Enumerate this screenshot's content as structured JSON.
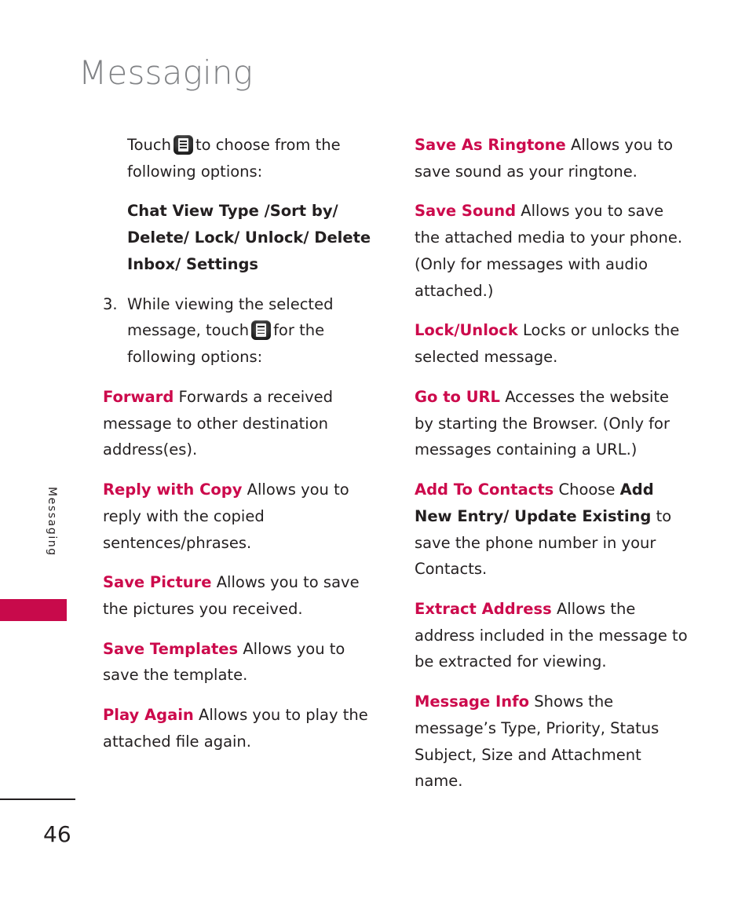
{
  "page": {
    "title": "Messaging",
    "side_tab_label": "Messaging",
    "page_number": "46",
    "accent_color": "#cc0a4c",
    "tab_color": "#c80a4b",
    "title_color": "#808285",
    "body_color": "#231f20"
  },
  "icons": {
    "menu_key": "menu-key-icon"
  },
  "left_column": {
    "intro": {
      "before_icon": "Touch",
      "after_icon": "to choose from the following options:"
    },
    "options_line": "Chat View Type /Sort by/ Delete/ Lock/ Unlock/ Delete Inbox/ Settings",
    "step": {
      "number": "3.",
      "before_icon": "While viewing the selected message, touch",
      "after_icon": "for the following options:"
    },
    "entries": [
      {
        "term": "Forward",
        "description": "Forwards a received message to other destination address(es)."
      },
      {
        "term": "Reply with Copy",
        "description": "Allows you to reply with the copied sentences/phrases."
      },
      {
        "term": "Save Picture",
        "description": "Allows you to save the pictures you received."
      },
      {
        "term": "Save Templates",
        "description": "Allows you to save the template."
      },
      {
        "term": "Play Again",
        "description": "Allows you to play the attached file again."
      }
    ]
  },
  "right_column": {
    "entries": [
      {
        "term": "Save As Ringtone",
        "description": "Allows you to save sound as your ringtone."
      },
      {
        "term": "Save Sound",
        "description": "Allows you to save the attached media to your phone. (Only for messages with audio attached.)"
      },
      {
        "term": "Lock/Unlock",
        "description": "Locks or unlocks the selected message."
      },
      {
        "term": "Go to URL",
        "description": "Accesses the website by starting the Browser. (Only for messages containing a URL.)"
      },
      {
        "term": "Add To Contacts",
        "description_1": "Choose",
        "emphasis": "Add New Entry/ Update Existing",
        "description_2": "to save the phone number in your Contacts."
      },
      {
        "term": "Extract Address",
        "description": "Allows the address included in the message to be extracted for viewing."
      },
      {
        "term": "Message Info",
        "description": "Shows the message’s Type, Priority, Status Subject, Size and Attachment name."
      }
    ]
  }
}
